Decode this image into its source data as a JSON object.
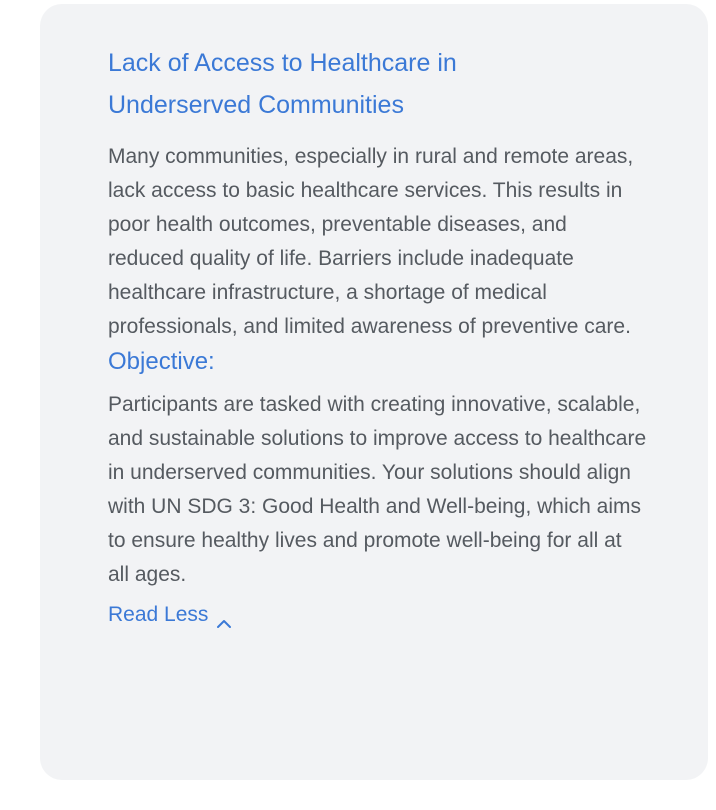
{
  "card": {
    "title": "Lack of Access to Healthcare in Underserved Communities",
    "description": "Many communities, especially in rural and remote areas, lack access to basic healthcare services. This results in poor health outcomes, preventable diseases, and reduced quality of life. Barriers include inadequate healthcare infrastructure, a shortage of medical professionals, and limited awareness of preventive care.",
    "objective_heading": "Objective:",
    "objective_text": "Participants are tasked with creating innovative, scalable, and sustainable solutions to improve access to healthcare in underserved communities. Your solutions should align with UN SDG 3: Good Health and Well-being, which aims to ensure healthy lives and promote well-being for all at all ages.",
    "toggle_label": "Read Less",
    "toggle_icon": "chevron-up-icon"
  },
  "colors": {
    "accent": "#3b79d6",
    "body_text": "#555a60",
    "card_bg": "#f2f3f5"
  }
}
